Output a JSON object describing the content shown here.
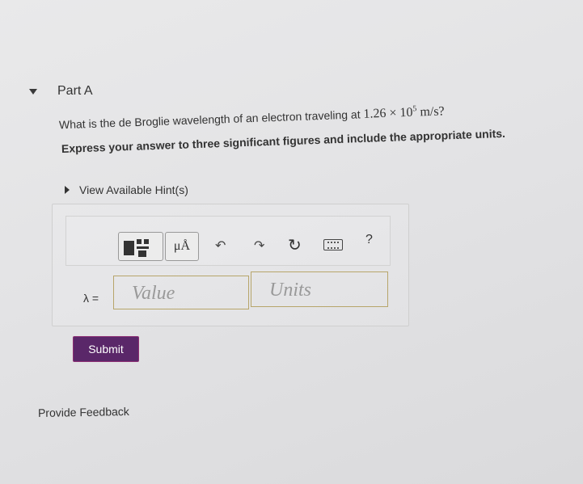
{
  "part": {
    "title": "Part A"
  },
  "question": {
    "prefix": "What is the de Broglie wavelength of an electron traveling at",
    "mantissa": "1.26",
    "times": "×",
    "base": "10",
    "exponent": "5",
    "unit": "m/s?"
  },
  "instruction": "Express your answer to three significant figures and include the appropriate units.",
  "hints": {
    "label": "View Available Hint(s)"
  },
  "toolbar": {
    "units_label": "μÅ",
    "help_label": "?",
    "icons": [
      "templates-icon",
      "units-icon",
      "undo-icon",
      "redo-icon",
      "reset-icon",
      "keyboard-icon",
      "help-icon"
    ]
  },
  "answer": {
    "variable_label": "λ =",
    "value_placeholder": "Value",
    "units_placeholder": "Units"
  },
  "submit": {
    "label": "Submit"
  },
  "feedback": {
    "label": "Provide Feedback"
  },
  "colors": {
    "submit_bg": "#5a2769",
    "submit_border": "#8c2f74",
    "input_border": "#b7a56a"
  }
}
